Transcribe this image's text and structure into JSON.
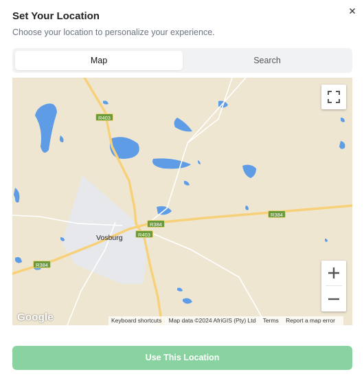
{
  "header": {
    "title": "Set Your Location",
    "subtitle": "Choose your location to personalize your experience."
  },
  "tabs": [
    {
      "label": "Map",
      "active": true
    },
    {
      "label": "Search",
      "active": false
    }
  ],
  "map": {
    "place_label": "Vosburg",
    "road_shields": [
      "R403",
      "R384",
      "R384",
      "R403",
      "R384"
    ],
    "provider_logo": "Google",
    "attribution": {
      "keyboard_shortcuts": "Keyboard shortcuts",
      "map_data": "Map data ©2024 AfriGIS (Pty) Ltd",
      "terms": "Terms",
      "report": "Report a map error"
    },
    "controls": {
      "fullscreen_icon": "fullscreen-icon",
      "zoom_in_icon": "plus-icon",
      "zoom_out_icon": "minus-icon"
    }
  },
  "footer": {
    "use_location_label": "Use This Location"
  },
  "colors": {
    "accent": "#89d3a0",
    "map_land": "#efe6d2",
    "map_water": "#5e9ce6",
    "map_road": "#f7d179",
    "town_area": "#e6e8ec"
  }
}
